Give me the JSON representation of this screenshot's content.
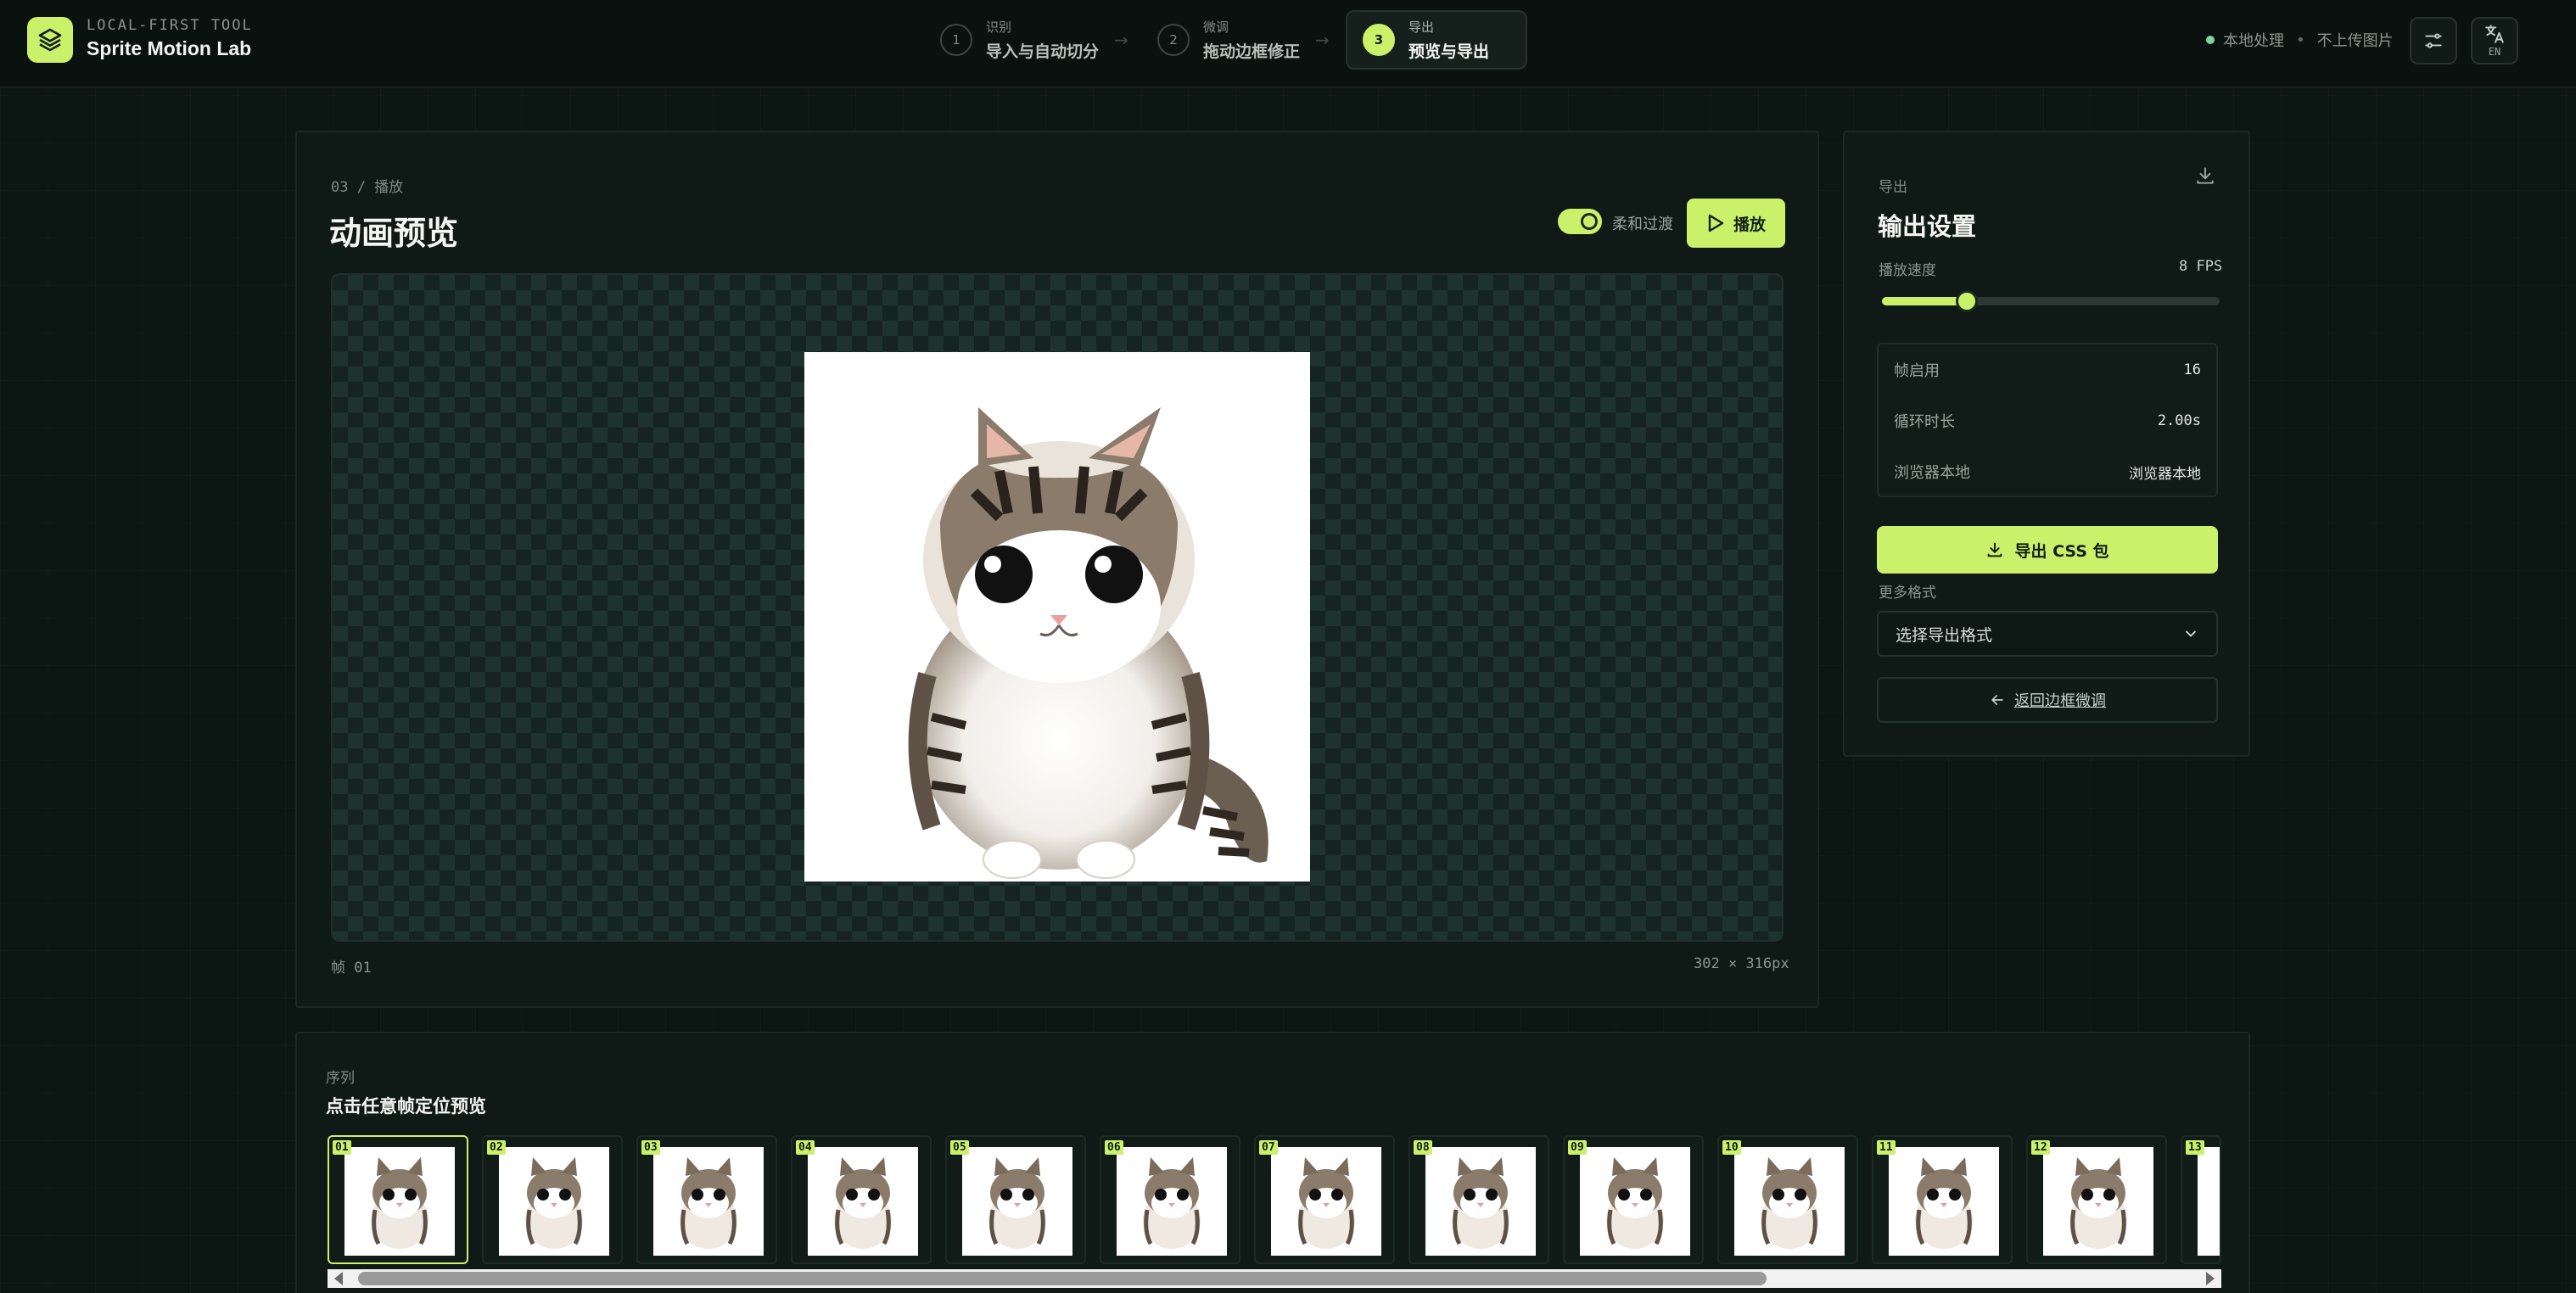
{
  "app": {
    "tagline": "LOCAL-FIRST TOOL",
    "title": "Sprite Motion Lab"
  },
  "steps": [
    {
      "num": "1",
      "small": "识别",
      "label": "导入与自动切分"
    },
    {
      "num": "2",
      "small": "微调",
      "label": "拖动边框修正"
    },
    {
      "num": "3",
      "small": "导出",
      "label": "预览与导出"
    }
  ],
  "status": {
    "local": "本地处理",
    "no_upload": "不上传图片"
  },
  "lang_button": "EN",
  "preview": {
    "crumb": "03 / 播放",
    "title": "动画预览",
    "smooth_label": "柔和过渡",
    "play_label": "播放",
    "frame_label": "帧 01",
    "size_label": "302 × 316px"
  },
  "export": {
    "crumb": "导出",
    "title": "输出设置",
    "speed_label": "播放速度",
    "speed_value": "8 FPS",
    "speed_fraction": 0.25,
    "stats": [
      {
        "k": "帧启用",
        "v": "16"
      },
      {
        "k": "循环时长",
        "v": "2.00s"
      },
      {
        "k": "浏览器本地",
        "v": "浏览器本地"
      }
    ],
    "export_button": "导出 CSS 包",
    "more_formats_label": "更多格式",
    "format_select": "选择导出格式",
    "back_button": "返回边框微调"
  },
  "sequence": {
    "crumb": "序列",
    "title": "点击任意帧定位预览",
    "frames": [
      "01",
      "02",
      "03",
      "04",
      "05",
      "06",
      "07",
      "08",
      "09",
      "10",
      "11",
      "12",
      "13"
    ]
  },
  "colors": {
    "accent": "#cbf06a",
    "background": "#0c1613"
  }
}
